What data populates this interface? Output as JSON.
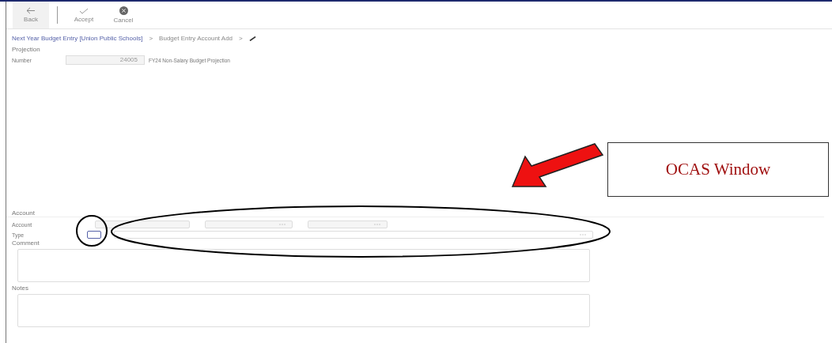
{
  "toolbar": [
    {
      "kind": "back",
      "label": "Back",
      "selected": true
    },
    {
      "kind": "accept",
      "label": "Accept",
      "selected": false
    },
    {
      "kind": "cancel",
      "label": "Cancel",
      "selected": false
    }
  ],
  "breadcrumb_separator": ">",
  "breadcrumb": [
    {
      "label": "Next Year Budget Entry [Union Public Schools]",
      "kind": "link"
    },
    {
      "label": "Budget Entry Account Add",
      "kind": "text"
    },
    {
      "kind": "pencil"
    }
  ],
  "projection": {
    "title": "Projection",
    "label": "Number",
    "number": "24005",
    "description": "FY24 Non-Salary Budget Projection"
  },
  "account": {
    "title": "Account",
    "account_label": "Account",
    "type_label": "Type",
    "comment_label": "Comment",
    "notes_label": "Notes"
  },
  "annotation": {
    "callout": "OCAS Window"
  }
}
